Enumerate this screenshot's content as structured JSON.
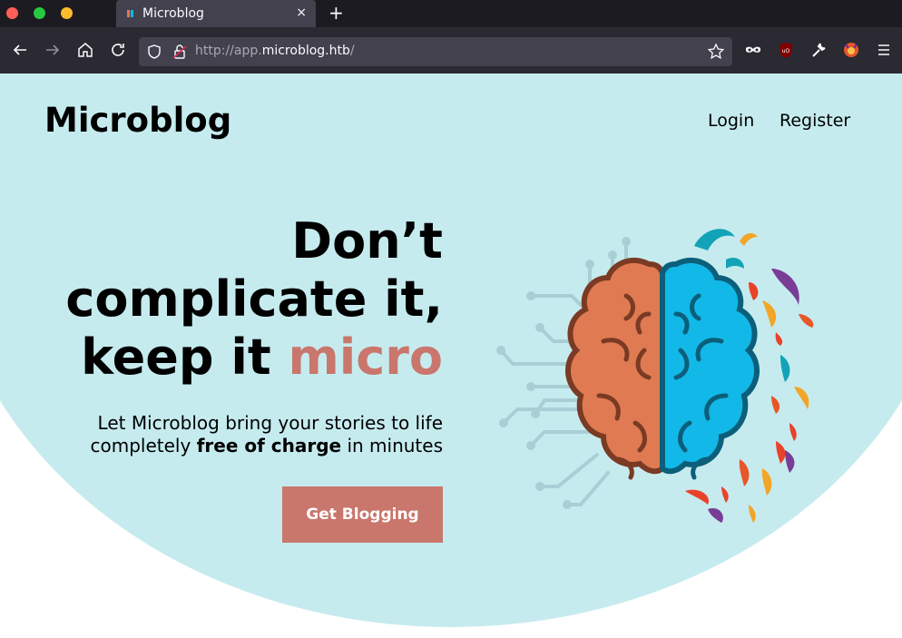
{
  "browser": {
    "tab_title": "Microblog",
    "new_tab_label": "+",
    "close_label": "×",
    "url_prefix": "http://app.",
    "url_host": "microblog.htb",
    "url_suffix": "/",
    "window_controls": [
      "close",
      "minimize",
      "maximize"
    ],
    "toolbar_icons": [
      "back-icon",
      "forward-icon",
      "home-icon",
      "reload-icon",
      "shield-icon",
      "lock-icon",
      "star-icon",
      "mask-icon",
      "ublock-icon",
      "wrench-icon",
      "fox-icon",
      "menu-icon"
    ]
  },
  "header": {
    "logo": "Microblog",
    "nav": {
      "login": "Login",
      "register": "Register"
    }
  },
  "hero": {
    "line1": "Don’t",
    "line2": "complicate it,",
    "line3_prefix": "keep it ",
    "line3_accent": "micro",
    "sub_line1": "Let Microblog bring your stories to life",
    "sub_prefix": "completely ",
    "sub_bold": "free of charge",
    "sub_suffix": " in minutes",
    "cta": "Get Blogging"
  },
  "colors": {
    "hero_bg": "#c6ebee",
    "accent": "#c9766c",
    "brain_left": "#e07a52",
    "brain_right": "#12b8e8"
  }
}
